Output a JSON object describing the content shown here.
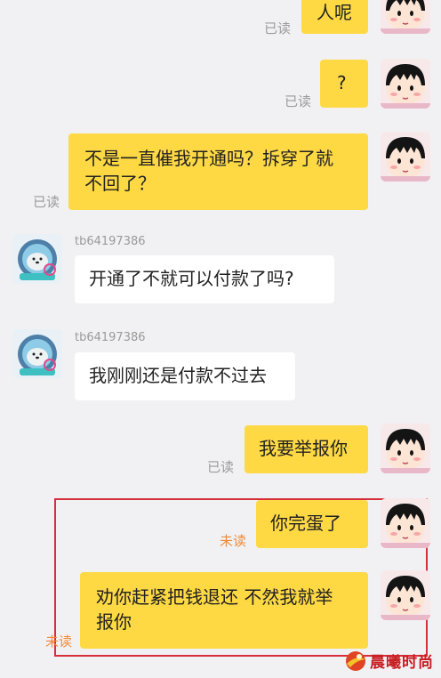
{
  "messages": [
    {
      "type": "outgoing",
      "text": "人呢",
      "status": "已读"
    },
    {
      "type": "outgoing",
      "text": "?",
      "status": "已读"
    },
    {
      "type": "outgoing",
      "text": "不是一直催我开通吗？拆穿了就\n不回了？",
      "status": "已读"
    },
    {
      "type": "incoming",
      "sender": "tb64197386",
      "text": "开通了不就可以付款了吗?"
    },
    {
      "type": "incoming",
      "sender": "tb64197386",
      "text": "我刚刚还是付款不过去"
    },
    {
      "type": "outgoing",
      "text": "我要举报你",
      "status": "已读"
    },
    {
      "type": "outgoing",
      "text": "你完蛋了",
      "status": "未读"
    },
    {
      "type": "outgoing",
      "text": "劝你赶紧把钱退还 不然我就举\n报你",
      "status": "未读"
    }
  ],
  "watermark": {
    "text": "晨曦时尚"
  },
  "colors": {
    "outgoing_bubble": "#fed944",
    "incoming_bubble": "#ffffff",
    "unread": "#f08a3a",
    "highlight_border": "#d62f3a"
  }
}
